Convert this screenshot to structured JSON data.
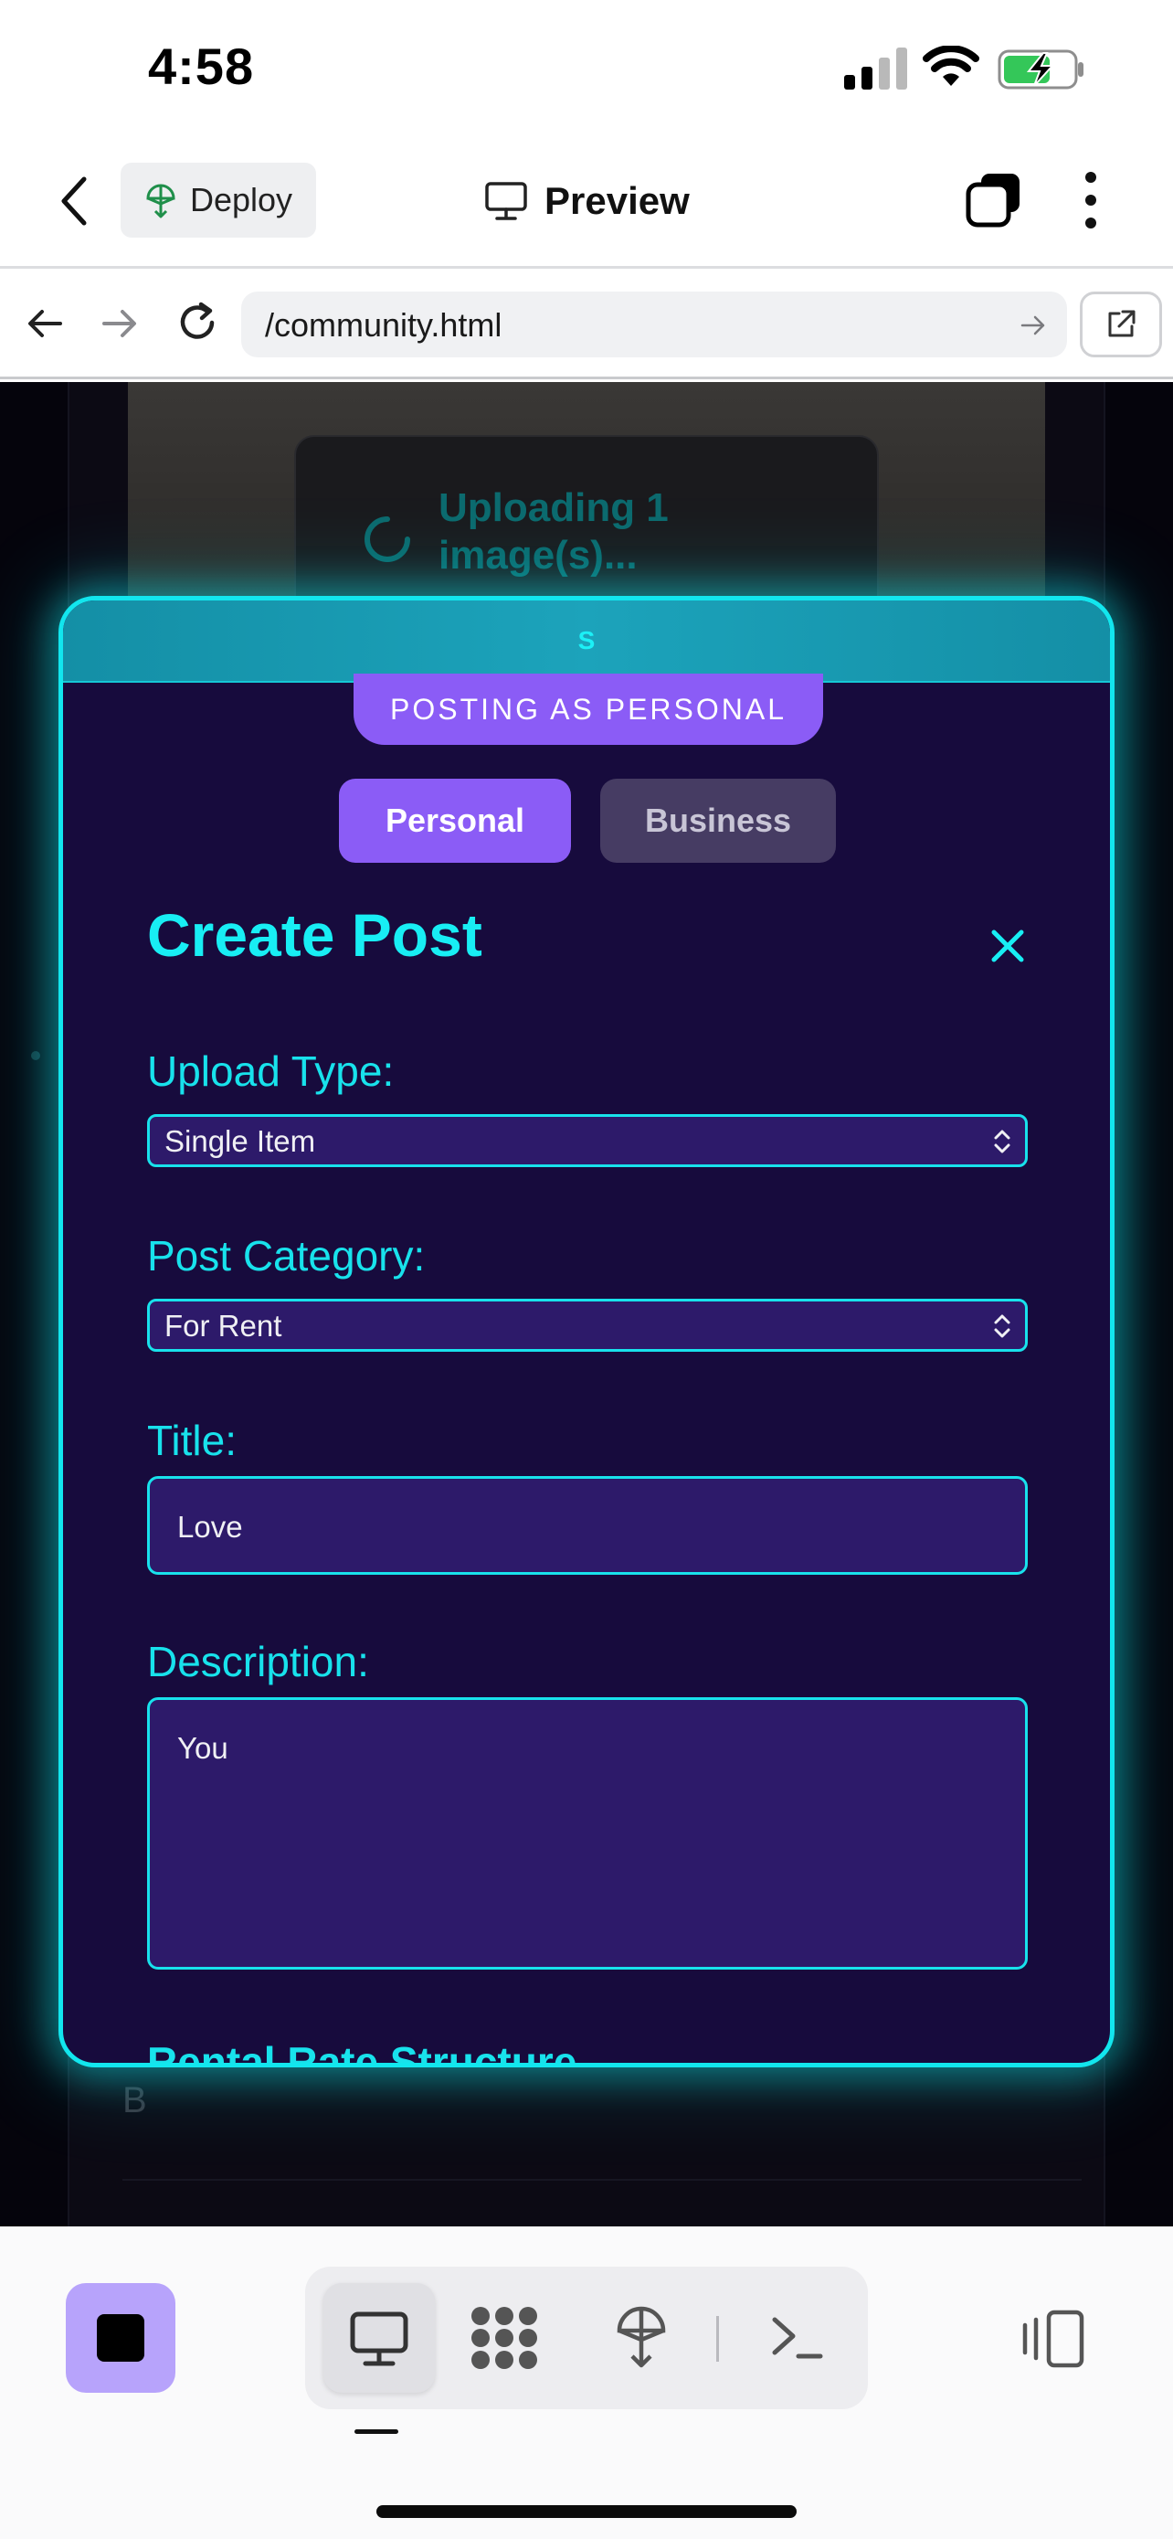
{
  "status_bar": {
    "time": "4:58"
  },
  "toolbar": {
    "deploy_label": "Deploy",
    "preview_label": "Preview"
  },
  "browser": {
    "url": "/community.html"
  },
  "background": {
    "upload_status": "Uploading 1 image(s)...",
    "partial_letter": "B"
  },
  "modal": {
    "header_text": "S",
    "posting_as": "POSTING AS PERSONAL",
    "account_options": [
      "Personal",
      "Business"
    ],
    "selected_account": "Personal",
    "title": "Create Post",
    "fields": {
      "upload_type": {
        "label": "Upload Type:",
        "value": "Single Item"
      },
      "post_category": {
        "label": "Post Category:",
        "value": "For Rent"
      },
      "title": {
        "label": "Title:",
        "value": "Love"
      },
      "description": {
        "label": "Description:",
        "value": "You"
      }
    },
    "next_section": "Rental Rate Structure"
  },
  "colors": {
    "accent_cyan": "#18e2ec",
    "modal_bg": "#170b3d",
    "purple": "#8b5cf6",
    "input_bg": "#2d1a6a"
  },
  "bottom_bar": {
    "icons": [
      "stop-icon",
      "desktop-icon",
      "apps-icon",
      "deploy-icon",
      "terminal-icon",
      "device-toggle-icon"
    ],
    "active_tool": "desktop-icon"
  }
}
